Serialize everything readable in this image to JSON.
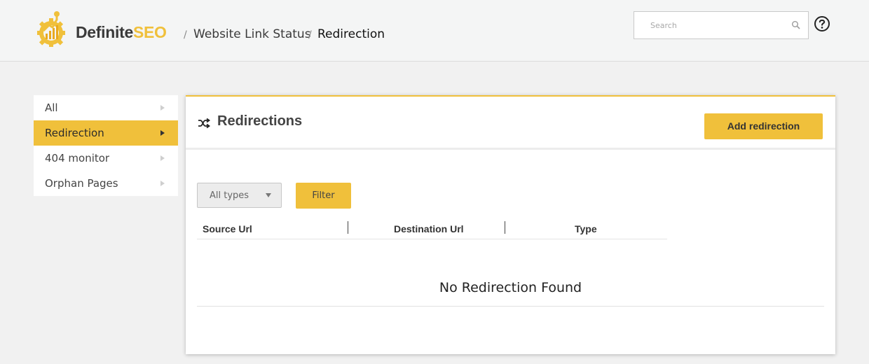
{
  "header": {
    "brand_part1": "Definite",
    "brand_part2": "SEO",
    "breadcrumb": [
      {
        "label": "Website Link Status"
      },
      {
        "label": "Redirection"
      }
    ],
    "separator": "/",
    "search_placeholder": "Search",
    "search_value": "",
    "search_icon": "search-icon",
    "help_icon": "question-circle-icon",
    "logo_icon": "gear-chart-logo"
  },
  "sidebar": {
    "items": [
      {
        "label": "All",
        "active": false
      },
      {
        "label": "Redirection",
        "active": true
      },
      {
        "label": "404 monitor",
        "active": false
      },
      {
        "label": "Orphan Pages",
        "active": false
      }
    ]
  },
  "main": {
    "title": "Redirections",
    "title_icon": "shuffle-icon",
    "add_button_label": "Add redirection",
    "type_select": {
      "selected": "All types"
    },
    "filter_button_label": "Filter",
    "table": {
      "columns": [
        "Source Url",
        "Destination Url",
        "Type"
      ],
      "rows": []
    },
    "empty_message": "No Redirection Found"
  },
  "colors": {
    "accent": "#f0c03b",
    "header_bg": "#f4f5f5",
    "page_bg": "#f1f1f1",
    "text_dark": "#333333"
  }
}
